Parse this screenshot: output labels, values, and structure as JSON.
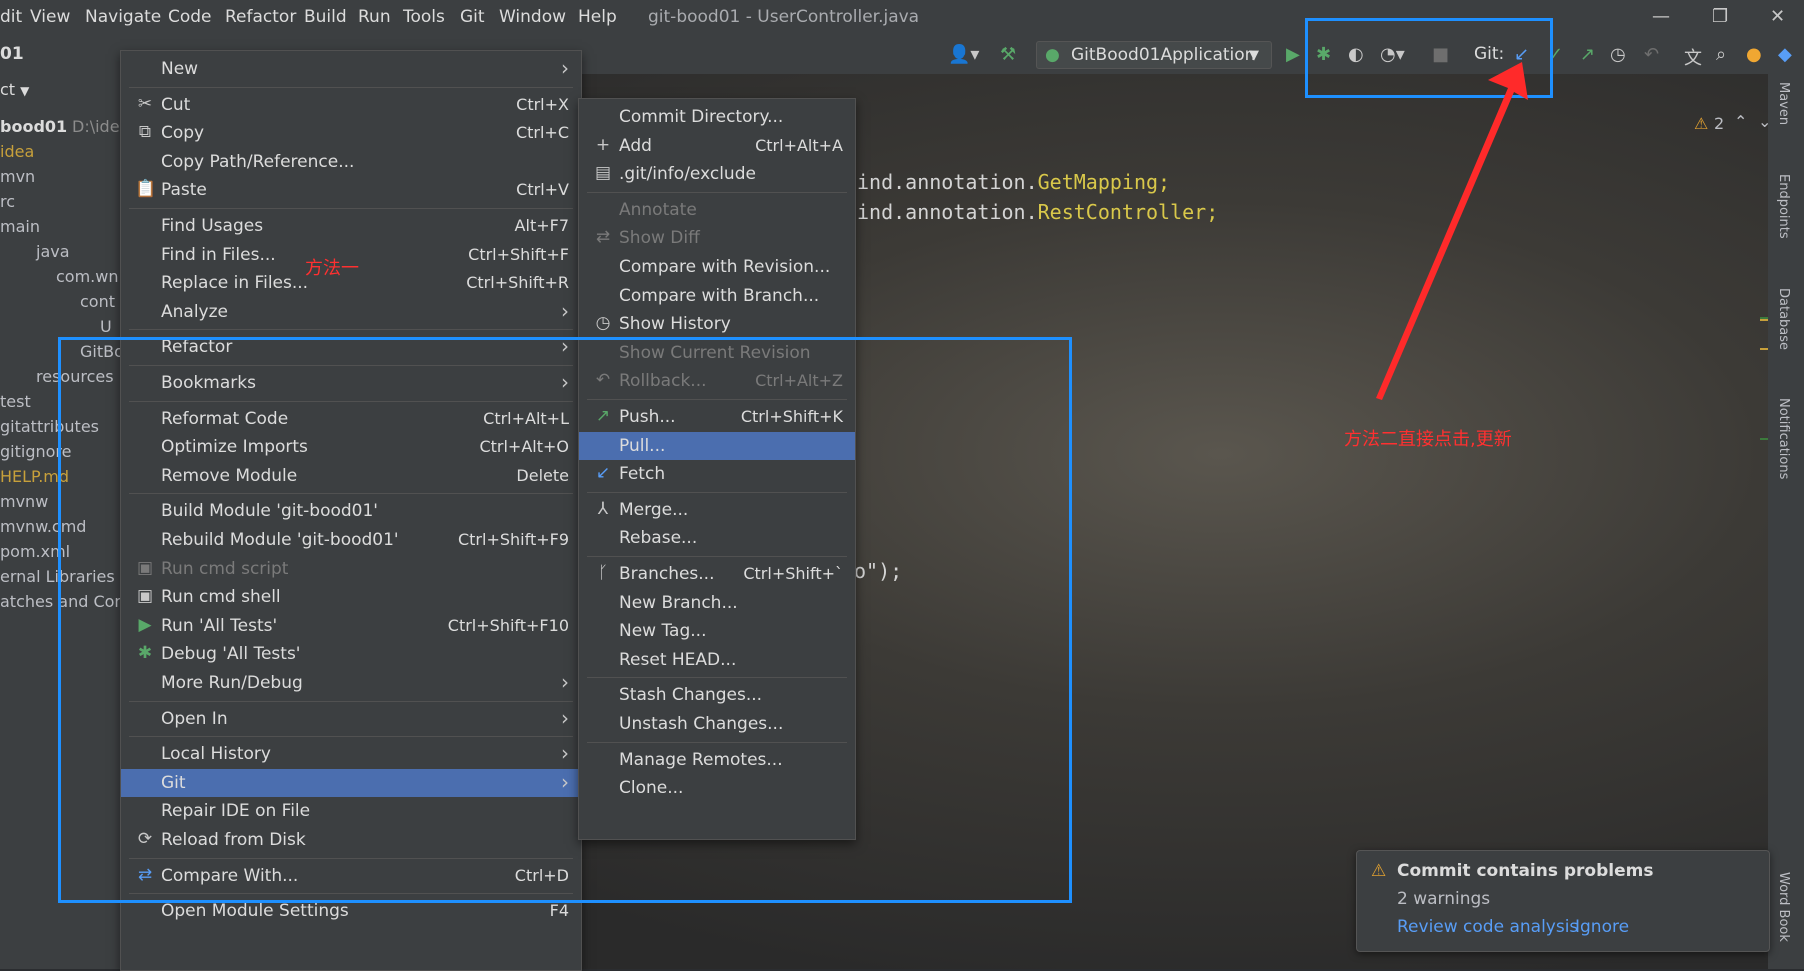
{
  "menubar": {
    "items": [
      "dit",
      "View",
      "Navigate",
      "Code",
      "Refactor",
      "Build",
      "Run",
      "Tools",
      "Git",
      "Window",
      "Help"
    ],
    "title": "git-bood01 - UserController.java"
  },
  "toolbar": {
    "breadcrumb": "01",
    "run_config": "GitBood01Application",
    "git_label": "Git:"
  },
  "project_panel": {
    "header": "ct",
    "tree": [
      {
        "label": "bood01",
        "suffix": "D:\\ide",
        "color": "#dcdcdc"
      },
      {
        "label": "idea",
        "color": "#c7a03b"
      },
      {
        "label": "mvn",
        "color": "#bcbec4"
      },
      {
        "label": "rc",
        "color": "#bcbec4"
      },
      {
        "label": "main",
        "color": "#bcbec4"
      },
      {
        "label": "java",
        "color": "#bcbec4"
      },
      {
        "label": "com.wn",
        "color": "#bcbec4"
      },
      {
        "label": "cont",
        "color": "#bcbec4"
      },
      {
        "label": "U",
        "color": "#bcbec4"
      },
      {
        "label": "GitBo",
        "color": "#bcbec4"
      },
      {
        "label": "resources",
        "color": "#bcbec4"
      },
      {
        "label": "test",
        "color": "#bcbec4"
      },
      {
        "label": "gitattributes",
        "color": "#bcbec4"
      },
      {
        "label": "gitignore",
        "color": "#bcbec4"
      },
      {
        "label": "HELP.md",
        "color": "#c7a03b"
      },
      {
        "label": "mvnw",
        "color": "#bcbec4"
      },
      {
        "label": "mvnw.cmd",
        "color": "#bcbec4"
      },
      {
        "label": "pom.xml",
        "color": "#bcbec4"
      },
      {
        "label": "ernal Libraries",
        "color": "#bcbec4"
      },
      {
        "label": "atches and Cons",
        "color": "#bcbec4"
      }
    ]
  },
  "editor": {
    "line1_prefix": "ind.annotation.",
    "line1_class": "GetMapping",
    "line1_end": ";",
    "line2_prefix": "ind.annotation.",
    "line2_class": "RestController",
    "line2_end": ";",
    "fragment": "o\");",
    "warnings_count": "2"
  },
  "context_menu": {
    "items": [
      {
        "label": "New",
        "submenu": true
      },
      {
        "sep": true
      },
      {
        "label": "Cut",
        "shortcut": "Ctrl+X",
        "icon": "✂"
      },
      {
        "label": "Copy",
        "shortcut": "Ctrl+C",
        "icon": "⧉"
      },
      {
        "label": "Copy Path/Reference..."
      },
      {
        "label": "Paste",
        "shortcut": "Ctrl+V",
        "icon": "📋"
      },
      {
        "sep": true
      },
      {
        "label": "Find Usages",
        "shortcut": "Alt+F7"
      },
      {
        "label": "Find in Files...",
        "shortcut": "Ctrl+Shift+F"
      },
      {
        "label": "Replace in Files...",
        "shortcut": "Ctrl+Shift+R"
      },
      {
        "label": "Analyze",
        "submenu": true
      },
      {
        "sep": true
      },
      {
        "label": "Refactor",
        "submenu": true
      },
      {
        "sep": true
      },
      {
        "label": "Bookmarks",
        "submenu": true
      },
      {
        "sep": true
      },
      {
        "label": "Reformat Code",
        "shortcut": "Ctrl+Alt+L"
      },
      {
        "label": "Optimize Imports",
        "shortcut": "Ctrl+Alt+O"
      },
      {
        "label": "Remove Module",
        "shortcut": "Delete"
      },
      {
        "sep": true
      },
      {
        "label": "Build Module 'git-bood01'"
      },
      {
        "label": "Rebuild Module 'git-bood01'",
        "shortcut": "Ctrl+Shift+F9"
      },
      {
        "label": "Run cmd script",
        "disabled": true,
        "icon": "▣"
      },
      {
        "label": "Run cmd shell",
        "icon": "▣"
      },
      {
        "label": "Run 'All Tests'",
        "shortcut": "Ctrl+Shift+F10",
        "icon": "▶",
        "icon_color": "#59a869"
      },
      {
        "label": "Debug 'All Tests'",
        "icon": "✱",
        "icon_color": "#59a869"
      },
      {
        "label": "More Run/Debug",
        "submenu": true
      },
      {
        "sep": true
      },
      {
        "label": "Open In",
        "submenu": true
      },
      {
        "sep": true
      },
      {
        "label": "Local History",
        "submenu": true
      },
      {
        "label": "Git",
        "submenu": true,
        "selected": true
      },
      {
        "label": "Repair IDE on File"
      },
      {
        "label": "Reload from Disk",
        "icon": "⟳"
      },
      {
        "sep": true
      },
      {
        "label": "Compare With...",
        "shortcut": "Ctrl+D",
        "icon": "⇄",
        "icon_color": "#589df6"
      },
      {
        "sep": true
      },
      {
        "label": "Open Module Settings",
        "shortcut": "F4"
      }
    ]
  },
  "git_submenu": {
    "items": [
      {
        "label": "Commit Directory..."
      },
      {
        "label": "Add",
        "shortcut": "Ctrl+Alt+A",
        "icon": "+"
      },
      {
        "label": ".git/info/exclude",
        "icon": "▤"
      },
      {
        "sep": true
      },
      {
        "label": "Annotate",
        "disabled": true
      },
      {
        "label": "Show Diff",
        "disabled": true,
        "icon": "⇄"
      },
      {
        "label": "Compare with Revision..."
      },
      {
        "label": "Compare with Branch..."
      },
      {
        "label": "Show History",
        "icon": "◷"
      },
      {
        "label": "Show Current Revision",
        "disabled": true
      },
      {
        "label": "Rollback...",
        "shortcut": "Ctrl+Alt+Z",
        "disabled": true,
        "icon": "↶"
      },
      {
        "sep": true
      },
      {
        "label": "Push...",
        "shortcut": "Ctrl+Shift+K",
        "icon": "↗",
        "icon_color": "#59a869"
      },
      {
        "label": "Pull...",
        "selected": true
      },
      {
        "label": "Fetch",
        "icon": "↙",
        "icon_color": "#589df6"
      },
      {
        "sep": true
      },
      {
        "label": "Merge...",
        "icon": "⅄"
      },
      {
        "label": "Rebase..."
      },
      {
        "sep": true
      },
      {
        "label": "Branches...",
        "shortcut": "Ctrl+Shift+`",
        "icon": "ᚴ"
      },
      {
        "label": "New Branch..."
      },
      {
        "label": "New Tag..."
      },
      {
        "label": "Reset HEAD..."
      },
      {
        "sep": true
      },
      {
        "label": "Stash Changes..."
      },
      {
        "label": "Unstash Changes..."
      },
      {
        "sep": true
      },
      {
        "label": "Manage Remotes..."
      },
      {
        "label": "Clone..."
      }
    ]
  },
  "annotations": {
    "method1": "方法一",
    "method2": "方法二直接点击,更新"
  },
  "right_strip": [
    "Maven",
    "Endpoints",
    "Database",
    "Notifications",
    "Word Book"
  ],
  "notification": {
    "title": "Commit contains problems",
    "body": "2 warnings",
    "link1": "Review code analysis",
    "link2": "Ignore"
  },
  "colors": {
    "accent": "#4b6eaf",
    "annotation_box": "#1e90ff",
    "annotation_text": "#ff3030",
    "link": "#589df6"
  }
}
